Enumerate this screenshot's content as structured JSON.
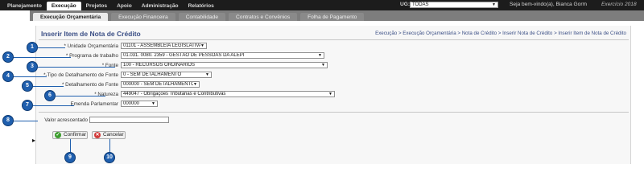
{
  "topnav": {
    "items": [
      "Planejamento",
      "Execução",
      "Projetos",
      "Apoio",
      "Administração",
      "Relatórios"
    ],
    "active_index": 1,
    "ug_label": "UG:",
    "ug_value": "TODAS",
    "welcome": "Seja bem-vindo(a), Bianca Gorm",
    "exercicio": "Exercício 2018"
  },
  "subnav": {
    "items": [
      "Execução Orçamentária",
      "Execução Financeira",
      "Contabilidade",
      "Contratos e Convênios",
      "Folha de Pagamento"
    ],
    "active_index": 0
  },
  "page": {
    "title": "Inserir Item de Nota de Crédito",
    "breadcrumb": "Execução > Execução Orçamentária > Nota de Crédito > Inserir Nota de Crédito > Inserir Item de Nota de Crédito"
  },
  "form": {
    "unidade_label": "* Unidade Orçamentária",
    "unidade_value": "01101 - ASSEMBLEIA LEGISLATIVA",
    "programa_label": "* Programa de trabalho",
    "programa_value": "01.031. 0080. 2359 - GESTÃO DE PESSOAS DA ALEPI",
    "fonte_label": "* Fonte",
    "fonte_value": "100 - RECURSOS ORDINÁRIOS",
    "tipo_label": "*-Tipo de Detalhamento de Fonte",
    "tipo_value": "0 - SEM DETALHAMENTO",
    "detalhamento_label": "* Detalhamento de Fonte",
    "detalhamento_value": "000000 - SEM DETALHAMENTO",
    "natureza_label": "* Natureza",
    "natureza_value": "449047 - Obrigações Tributárias e Contributivas",
    "emenda_label": "Emenda Parlamentar",
    "emenda_value": "000000",
    "valor_label": "Valor acrescentado",
    "valor_value": ""
  },
  "buttons": {
    "confirm_label": "Confirmar",
    "cancel_label": "Cancelar"
  },
  "callouts": [
    "1",
    "2",
    "3",
    "4",
    "5",
    "6",
    "7",
    "8",
    "9",
    "10"
  ],
  "colors": {
    "topbar": "#1c1c1c",
    "subbar": "#7d7d7d",
    "title": "#3a4e85",
    "badge": "#1f5fae"
  }
}
